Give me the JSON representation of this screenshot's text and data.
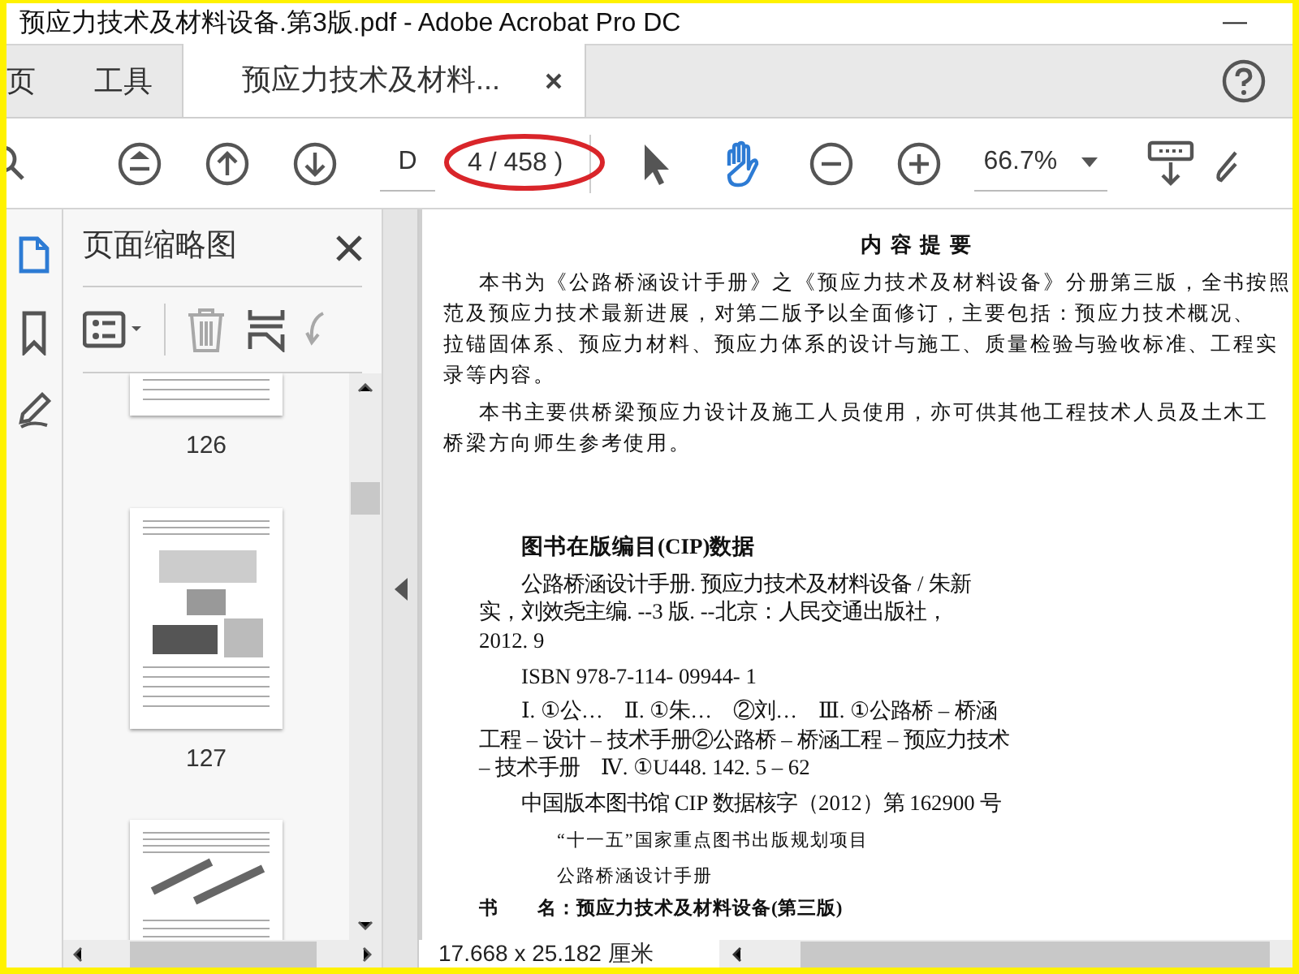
{
  "window": {
    "title": "预应力技术及材料设备.第3版.pdf - Adobe Acrobat Pro DC",
    "minimize": "—"
  },
  "tabs": [
    {
      "label": "页",
      "selected": false
    },
    {
      "label": "工具",
      "selected": false
    },
    {
      "label": "预应力技术及材料...",
      "selected": true
    }
  ],
  "toolbar": {
    "page_field": {
      "value": "D"
    },
    "page_count": "4 / 458 )",
    "tools": [
      {
        "kind": "select",
        "selected": false
      },
      {
        "kind": "hand",
        "selected": true
      }
    ],
    "zoom": {
      "value": "66.7%"
    }
  },
  "nav_pane": {
    "items": [
      {
        "kind": "pages",
        "selected": true
      },
      {
        "kind": "bookmark",
        "selected": false
      },
      {
        "kind": "signature",
        "selected": false
      }
    ]
  },
  "thumbnail_panel": {
    "title": "页面缩略图",
    "thumbnails": [
      {
        "kind": "cut",
        "label": "126"
      },
      {
        "kind": "figure",
        "label": "127"
      },
      {
        "kind": "top"
      }
    ]
  },
  "document": {
    "blocks": [
      {
        "kind": "title",
        "text": "内 容 提 要"
      },
      {
        "kind": "intro",
        "lines": [
          "本书为《公路桥涵设计手册》之《预应力技术及材料设备》分册第三版，全书按照",
          "范及预应力技术最新进展，对第二版予以全面修订，主要包括：预应力技术概况、",
          "拉锚固体系、预应力材料、预应力体系的设计与施工、质量检验与验收标准、工程实",
          "录等内容。"
        ]
      },
      {
        "kind": "intro",
        "lines": [
          "本书主要供桥梁预应力设计及施工人员使用，亦可供其他工程技术人员及土木工",
          "桥梁方向师生参考使用。"
        ]
      },
      {
        "kind": "heading",
        "text": "图书在版编目(CIP)数据"
      },
      {
        "kind": "cip",
        "lines": [
          "公路桥涵设计手册. 预应力技术及材料设备 / 朱新",
          "实，刘效尧主编. --3 版. --北京：人民交通出版社，",
          "2012. 9"
        ]
      },
      {
        "kind": "cip",
        "lines": [
          "ISBN 978-7-114- 09944- 1"
        ]
      },
      {
        "kind": "cip",
        "lines": [
          "Ⅰ. ①公…　Ⅱ. ①朱…　②刘…　Ⅲ. ①公路桥 – 桥涵",
          "工程 – 设计 – 技术手册②公路桥 – 桥涵工程 – 预应力技术",
          "– 技术手册　Ⅳ. ①U448. 142. 5 – 62"
        ]
      },
      {
        "kind": "cip",
        "lines": [
          "中国版本图书馆 CIP 数据核字（2012）第 162900 号"
        ]
      },
      {
        "kind": "project",
        "lines": [
          "“十一五”国家重点图书出版规划项目"
        ]
      },
      {
        "kind": "project",
        "lines": [
          "公路桥涵设计手册"
        ]
      },
      {
        "kind": "field",
        "text": "书　　名：预应力技术及材料设备(第三版)"
      }
    ]
  },
  "status_bar": {
    "page_size": "17.668 x 25.182 厘米"
  }
}
